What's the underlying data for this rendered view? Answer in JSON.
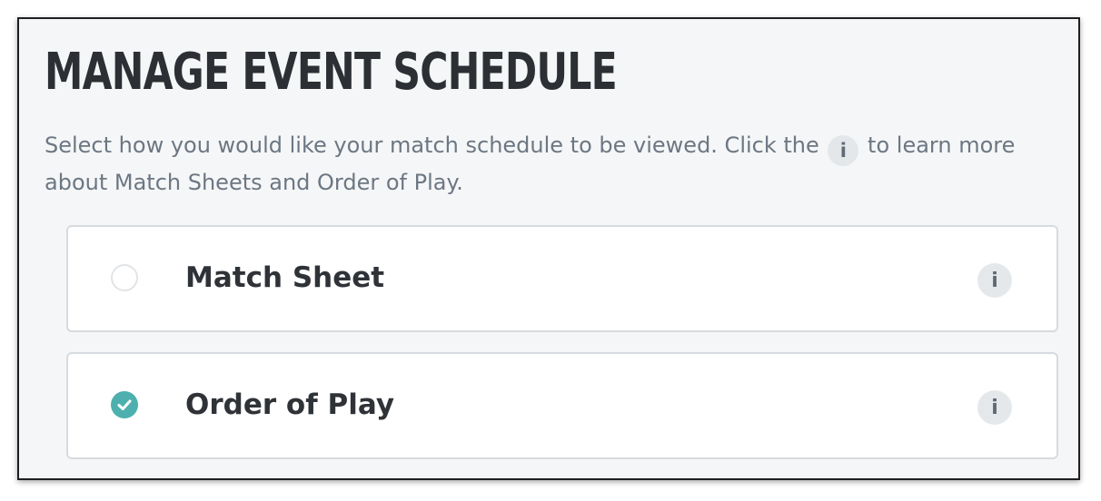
{
  "header": {
    "title": "MANAGE EVENT SCHEDULE"
  },
  "description": {
    "before_icon": "Select how you would like your match schedule to be viewed. Click the",
    "icon_glyph": "i",
    "after_icon": "to learn more about Match Sheets and Order of Play."
  },
  "options": [
    {
      "label": "Match Sheet",
      "selected": false,
      "info_glyph": "i",
      "radio_icon": "radio-unchecked-icon",
      "info_icon": "info-icon"
    },
    {
      "label": "Order of Play",
      "selected": true,
      "info_glyph": "i",
      "radio_icon": "radio-checked-icon",
      "info_icon": "info-icon"
    }
  ],
  "colors": {
    "accent": "#4db0ae",
    "title": "#2c3035",
    "description": "#6c7783",
    "panel_background": "#f5f6f7",
    "option_border": "#d7dbdf"
  }
}
